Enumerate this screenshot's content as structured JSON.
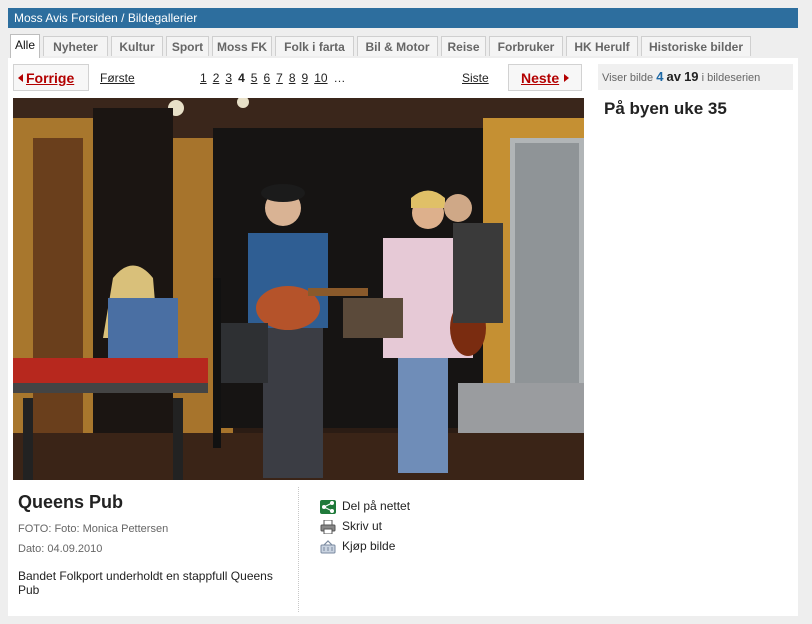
{
  "breadcrumb": "Moss Avis Forsiden / Bildegallerier",
  "tabs": [
    "Alle",
    "Nyheter",
    "Kultur",
    "Sport",
    "Moss FK",
    "Folk i farta",
    "Bil & Motor",
    "Reise",
    "Forbruker",
    "HK Herulf",
    "Historiske bilder"
  ],
  "pager": {
    "prev_label": "Forrige",
    "first_label": "Første",
    "pages": [
      "1",
      "2",
      "3",
      "4",
      "5",
      "6",
      "7",
      "8",
      "9",
      "10"
    ],
    "current_page": "4",
    "ellipsis": "…",
    "last_label": "Siste",
    "next_label": "Neste"
  },
  "counter": {
    "prefix": "Viser bilde",
    "current": "4",
    "of": "av",
    "total": "19",
    "suffix": "i bildeserien"
  },
  "series_title": "På byen uke 35",
  "caption": {
    "title": "Queens Pub",
    "foto": "FOTO: Foto: Monica Pettersen",
    "date": "Dato: 04.09.2010",
    "description": "Bandet Folkport underholdt en stappfull Queens Pub"
  },
  "actions": {
    "share": "Del på nettet",
    "print": "Skriv ut",
    "buy": "Kjøp bilde"
  },
  "colors": {
    "topbar": "#2d6e9e",
    "pager_link": "#b30000",
    "counter_accent": "#1e69a6",
    "share_icon": "#1f7a3a"
  }
}
